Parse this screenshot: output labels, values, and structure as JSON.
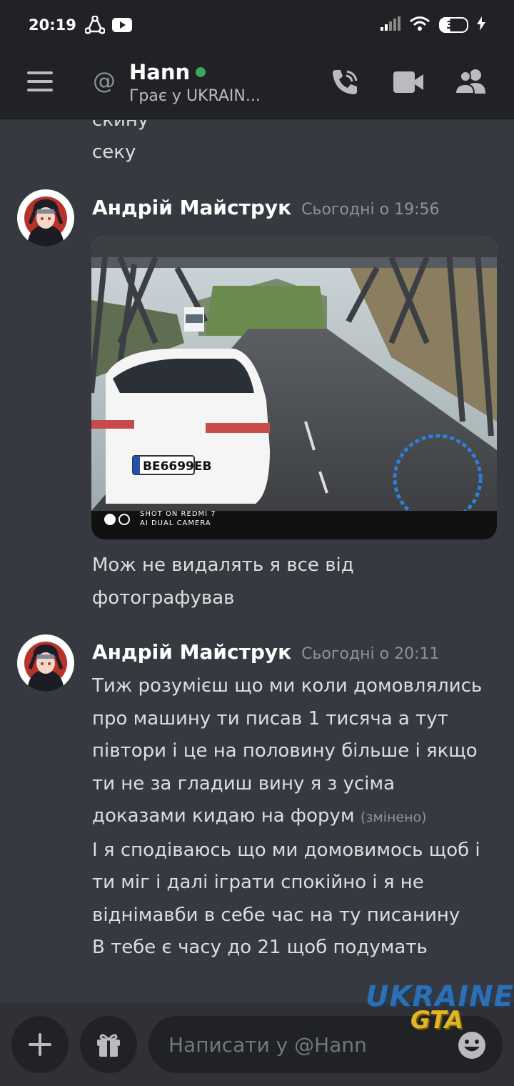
{
  "status_bar": {
    "time": "20:19",
    "battery": "37"
  },
  "header": {
    "at_symbol": "@",
    "title": "Hann",
    "subtitle": "Грає у UKRAIN..."
  },
  "messages": {
    "partial_top": "скину",
    "prev_line": "секу",
    "group1": {
      "author": "Андрій Майструк",
      "timestamp": "Сьогодні о 19:56",
      "photo": {
        "plate": "BE6699EB",
        "caption_line1": "SHOT ON REDMI 7",
        "caption_line2": "AI DUAL CAMERA"
      },
      "text_line1": "Мож не видалять я все від",
      "text_line2": "фотографував"
    },
    "group2": {
      "author": "Андрій Майструк",
      "timestamp": "Сьогодні о 20:11",
      "lines": [
        "Тиж розумієш що ми коли домовлялись",
        "про машину ти писав 1 тисяча а тут",
        "півтори і це на половину більше і якщо",
        "ти не за гладиш вину я з усіма",
        "доказами кидаю на форум"
      ],
      "edited": "(змінено)",
      "lines2": [
        "І я сподіваюсь що ми домовимось щоб і",
        "ти міг і далі іграти спокійно і я не",
        "віднімавби в себе час на ту писанину",
        "В тебе є часу до 21 щоб подумать"
      ]
    }
  },
  "composer": {
    "placeholder": "Написати у @Hann"
  },
  "watermark": {
    "line1": "UKRAINE",
    "line2": "GTA"
  },
  "colors": {
    "background": "#36393f",
    "header": "#202225",
    "online": "#3ba55d",
    "muted": "#8e9297"
  }
}
